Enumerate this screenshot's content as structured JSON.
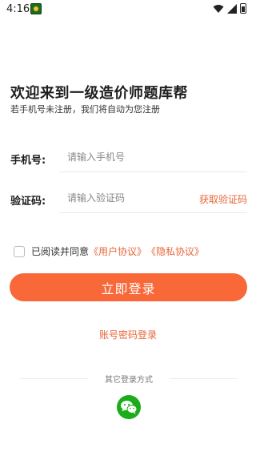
{
  "status_bar": {
    "time": "4:16"
  },
  "header": {
    "title": "欢迎来到一级造价师题库帮",
    "subtitle": "若手机号未注册，我们将自动为您注册"
  },
  "form": {
    "phone_label": "手机号:",
    "phone_placeholder": "请输入手机号",
    "code_label": "验证码:",
    "code_placeholder": "请输入验证码",
    "get_code": "获取验证码"
  },
  "agreement": {
    "prefix": "已阅读并同意",
    "user_agreement": "《用户协议》",
    "privacy_agreement": "《隐私协议》",
    "checked": false
  },
  "login_button": "立即登录",
  "password_login": "账号密码登录",
  "other_login": {
    "label": "其它登录方式",
    "wechat_icon": "wechat-icon"
  },
  "colors": {
    "accent": "#f86838",
    "link": "#e8663a",
    "wechat": "#1aad19"
  }
}
